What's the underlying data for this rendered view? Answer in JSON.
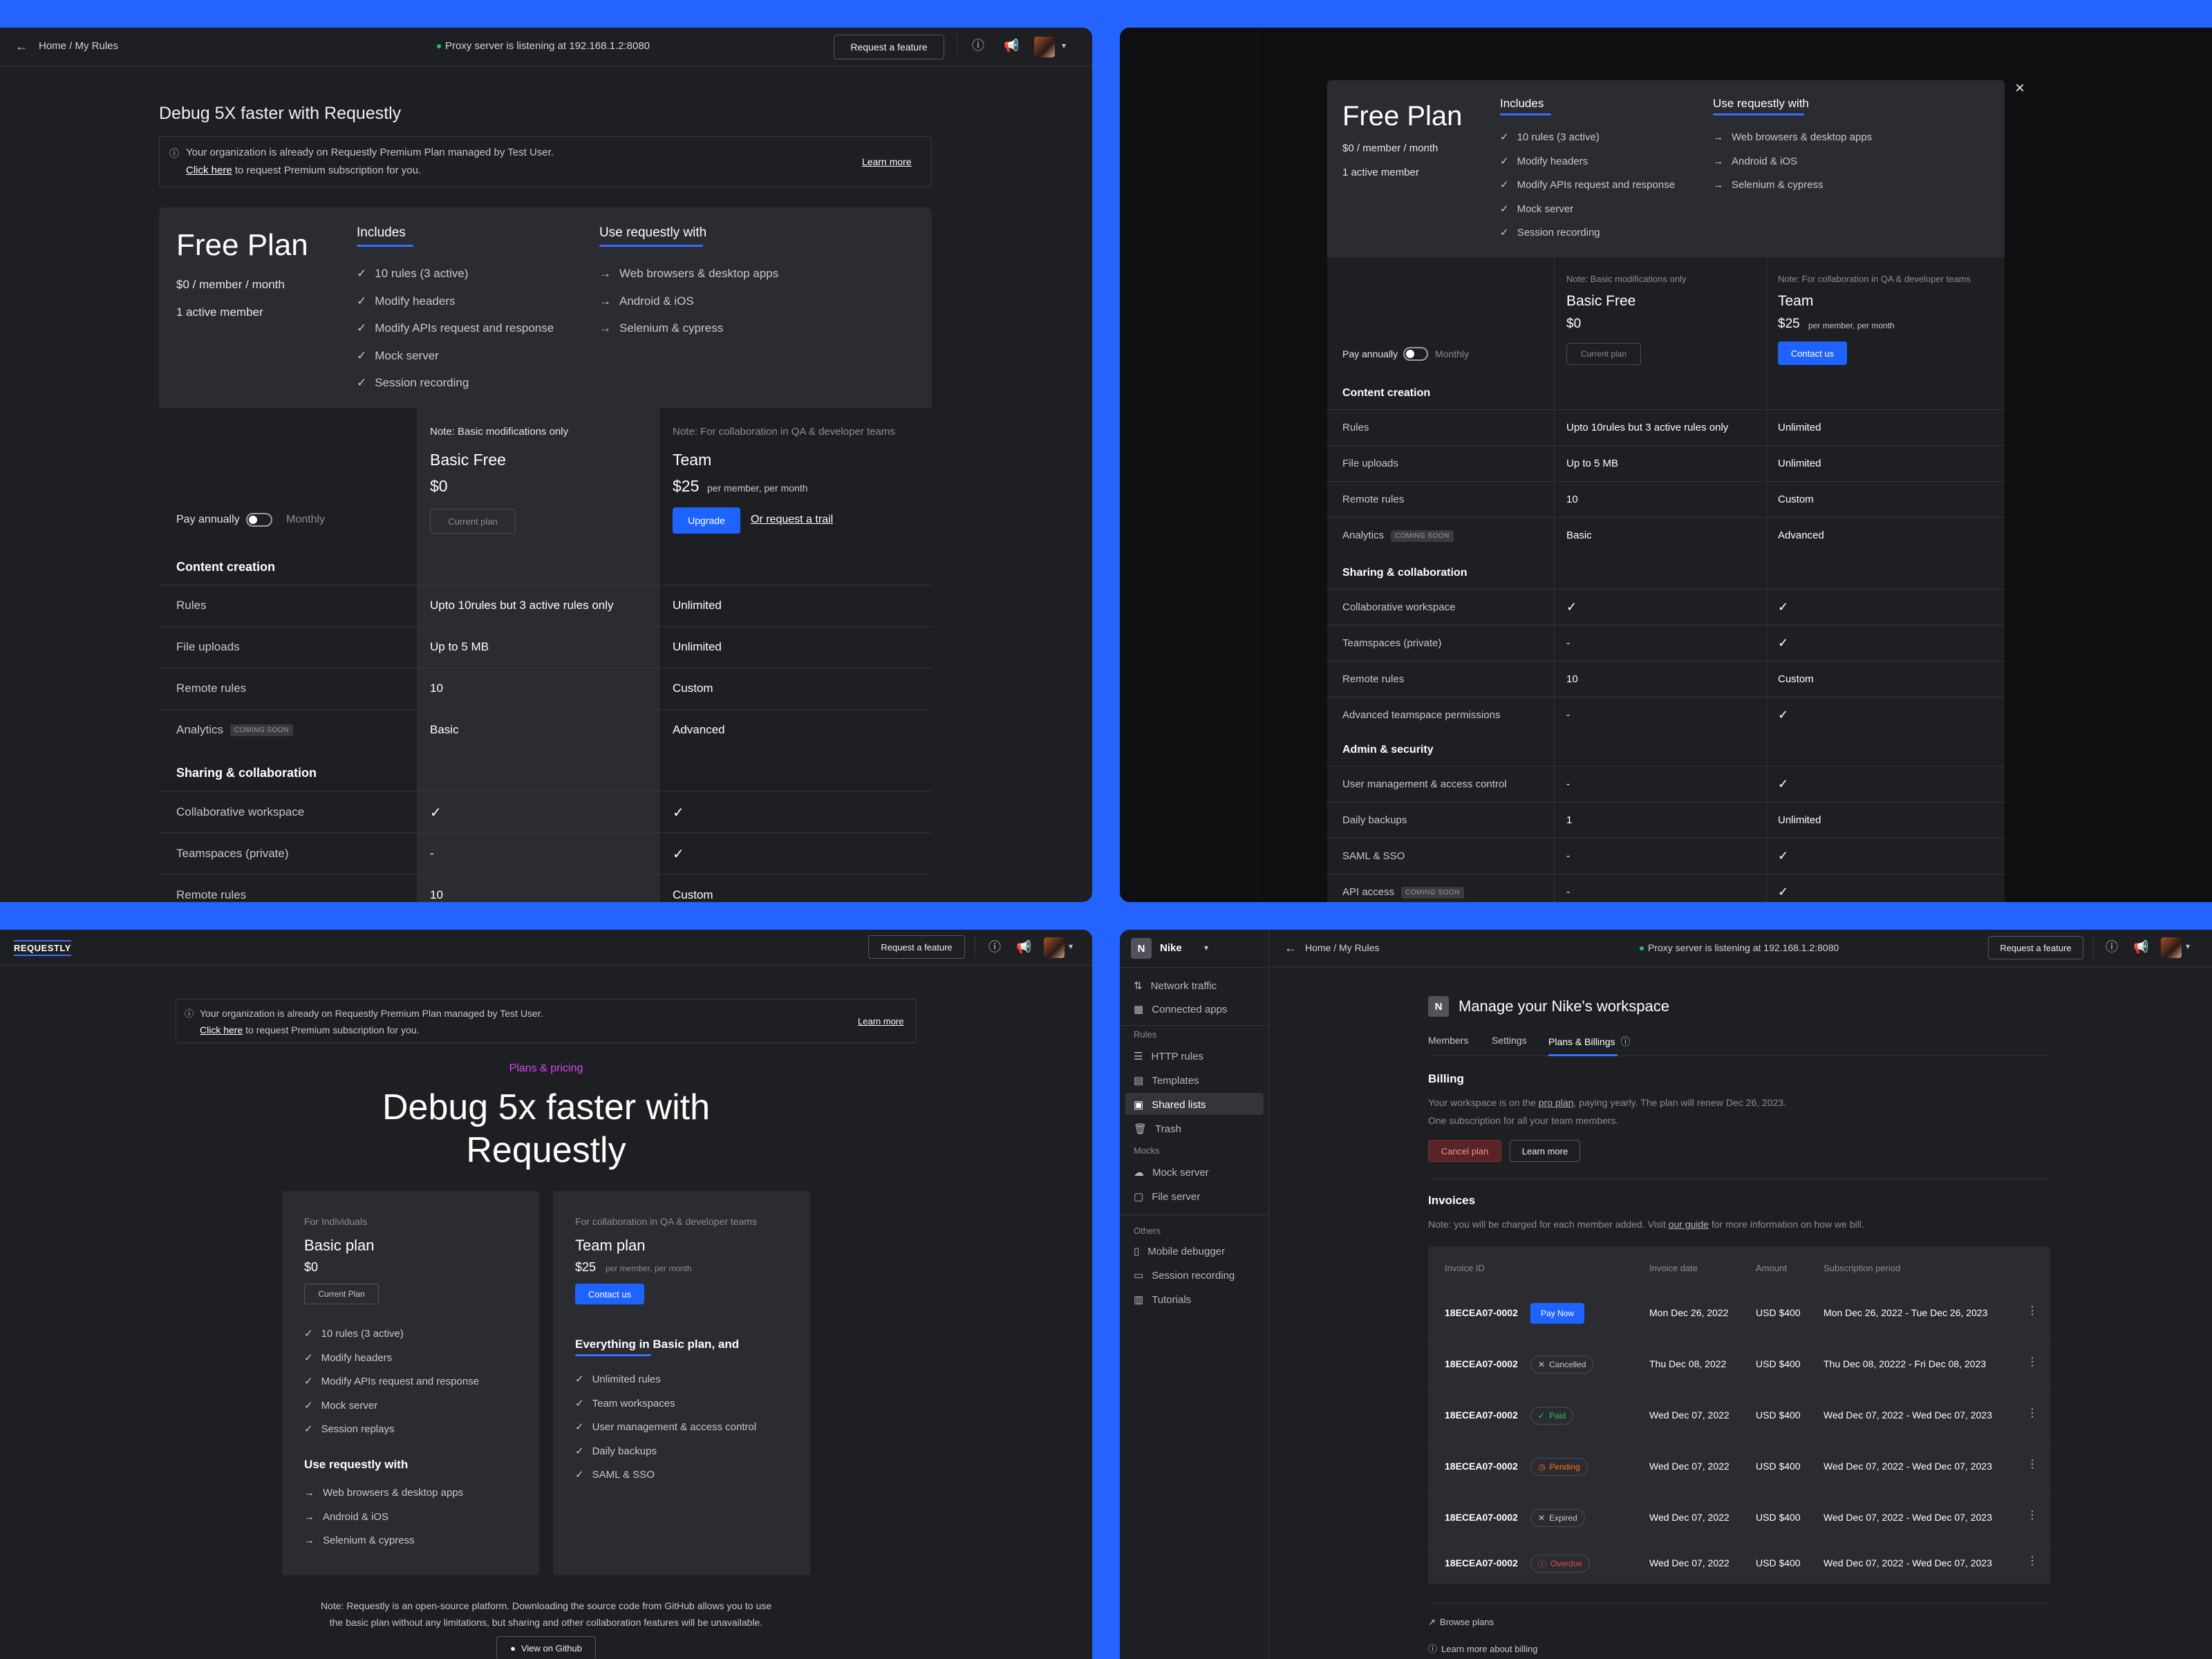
{
  "common": {
    "breadcrumb": "Home / My Rules",
    "proxy_status": "Proxy server is listening at 192.168.1.2:8080",
    "request_feature": "Request a feature",
    "learn_more": "Learn more",
    "click_here": "Click here",
    "org_notice_1": "Your organization is already on Requestly Premium Plan managed by Test User.",
    "org_notice_2": " to request Premium subscription for you."
  },
  "plan": {
    "free_plan_title": "Free Plan",
    "price_line": "$0 / member / month",
    "active_members": "1 active member",
    "includes_title": "Includes",
    "includes": [
      "10 rules (3 active)",
      "Modify headers",
      "Modify APIs request and response",
      "Mock server",
      "Session recording"
    ],
    "use_with_title": "Use requestly with",
    "use_with": [
      "Web browsers & desktop apps",
      "Android & iOS",
      "Selenium & cypress"
    ],
    "pay_annually": "Pay annually",
    "monthly": "Monthly",
    "basic": {
      "note": "Note: Basic modifications only",
      "name": "Basic Free",
      "price": "$0",
      "current": "Current plan"
    },
    "team": {
      "note": "Note: For collaboration in QA & developer teams",
      "name": "Team",
      "price": "$25",
      "per": "per member, per month",
      "upgrade": "Upgrade",
      "trial": "Or request a trail",
      "contact": "Contact us"
    },
    "coming_soon": "COMING SOON",
    "sec_content": "Content creation",
    "sec_sharing": "Sharing & collaboration",
    "sec_admin": "Admin & security",
    "rows_content": [
      {
        "label": "Rules",
        "basic": "Upto 10rules but 3 active rules only",
        "team": "Unlimited"
      },
      {
        "label": "File uploads",
        "basic": "Up to 5 MB",
        "team": "Unlimited"
      },
      {
        "label": "Remote rules",
        "basic": "10",
        "team": "Custom"
      },
      {
        "label": "Analytics",
        "basic": "Basic",
        "team": "Advanced"
      }
    ],
    "rows_sharing": [
      {
        "label": "Collaborative workspace",
        "basic": "✓",
        "team": "✓"
      },
      {
        "label": "Teamspaces (private)",
        "basic": "-",
        "team": "✓"
      },
      {
        "label": "Remote rules",
        "basic": "10",
        "team": "Custom"
      },
      {
        "label": "Advanced teamspace permissions",
        "basic": "-",
        "team": "✓"
      }
    ],
    "rows_admin": [
      {
        "label": "User management & access control",
        "basic": "-",
        "team": "✓"
      },
      {
        "label": "Daily backups",
        "basic": "1",
        "team": "Unlimited"
      },
      {
        "label": "SAML & SSO",
        "basic": "-",
        "team": "✓"
      },
      {
        "label": "API access",
        "basic": "-",
        "team": "✓"
      }
    ]
  },
  "p1": {
    "heading": "Debug 5X faster with Requestly"
  },
  "p3": {
    "logo": "REQUESTLY",
    "eyebrow": "Plans & pricing",
    "heading_1": "Debug 5x faster with",
    "heading_2": "Requestly",
    "basic_card": {
      "label": "For Individuals",
      "name": "Basic plan",
      "price": "$0",
      "button": "Current Plan",
      "features": [
        "10 rules (3 active)",
        "Modify headers",
        "Modify APIs request and response",
        "Mock server",
        "Session replays"
      ],
      "use_title": "Use requestly with",
      "use": [
        "Web browsers & desktop apps",
        "Android & iOS",
        "Selenium & cypress"
      ]
    },
    "team_card": {
      "label": "For collaboration in QA & developer teams",
      "name": "Team plan",
      "price": "$25",
      "per": "per member, per month",
      "button": "Contact us",
      "everything": "Everything in Basic plan, and",
      "features": [
        "Unlimited rules",
        "Team workspaces",
        "User management & access control",
        "Daily backups",
        "SAML & SSO"
      ]
    },
    "note_1": "Note: Requestly is an open-source platform. Downloading the source code from GitHub allows you to use",
    "note_2": "the basic plan without any limitations, but sharing and other collaboration features will be unavailable.",
    "github": "View on Github"
  },
  "p4": {
    "workspace_initial": "N",
    "workspace_name": "Nike",
    "sidebar": {
      "top": [
        "Network traffic",
        "Connected apps"
      ],
      "rules_title": "Rules",
      "rules": [
        "HTTP rules",
        "Templates",
        "Shared lists",
        "Trash"
      ],
      "mocks_title": "Mocks",
      "mocks": [
        "Mock server",
        "File server"
      ],
      "others_title": "Others",
      "others": [
        "Mobile debugger",
        "Session recording",
        "Tutorials"
      ]
    },
    "title": "Manage your Nike's workspace",
    "tabs": [
      "Members",
      "Settings",
      "Plans & Billings"
    ],
    "billing_title": "Billing",
    "billing_text_1a": "Your workspace is on the ",
    "billing_link": "pro plan",
    "billing_text_1b": ", paying yearly. The plan will renew Dec 26, 2023.",
    "billing_text_2": "One subscription for all your team members.",
    "cancel_plan": "Cancel plan",
    "learn_more": "Learn more",
    "invoices_title": "Invoices",
    "invoice_note_a": "Note: you will be charged for each member added. Visit ",
    "invoice_note_link": "our guide",
    "invoice_note_b": " for more information on how we bill.",
    "columns": [
      "Invoice  ID",
      "Invoice date",
      "Amount",
      "Subscription period"
    ],
    "invoices": [
      {
        "id": "18ECEA07-0002",
        "status": "Pay Now",
        "date": "Mon Dec 26, 2022",
        "amount": "USD $400",
        "period": "Mon Dec 26, 2022 - Tue Dec 26, 2023"
      },
      {
        "id": "18ECEA07-0002",
        "status": "Cancelled",
        "date": "Thu Dec 08, 2022",
        "amount": "USD $400",
        "period": "Thu Dec 08, 20222 - Fri Dec 08, 2023"
      },
      {
        "id": "18ECEA07-0002",
        "status": "Paid",
        "date": "Wed Dec 07, 2022",
        "amount": "USD $400",
        "period": "Wed Dec 07, 2022 - Wed Dec 07, 2023"
      },
      {
        "id": "18ECEA07-0002",
        "status": "Pending",
        "date": "Wed Dec 07, 2022",
        "amount": "USD $400",
        "period": "Wed Dec 07, 2022 - Wed Dec 07, 2023"
      },
      {
        "id": "18ECEA07-0002",
        "status": "Expired",
        "date": "Wed Dec 07, 2022",
        "amount": "USD $400",
        "period": "Wed Dec 07, 2022 - Wed Dec 07, 2023"
      },
      {
        "id": "18ECEA07-0002",
        "status": "Overdue",
        "date": "Wed Dec 07, 2022",
        "amount": "USD $400",
        "period": "Wed Dec 07, 2022 - Wed Dec 07, 2023"
      }
    ],
    "browse_plans": "Browse plans",
    "learn_billing": "Learn more about billing"
  },
  "colors": {
    "accent": "#1f63ff",
    "background": "#2563ff",
    "paid": "#22c55e",
    "pending": "#f97316",
    "overdue": "#ef4444",
    "eyebrow": "#d946ef"
  }
}
